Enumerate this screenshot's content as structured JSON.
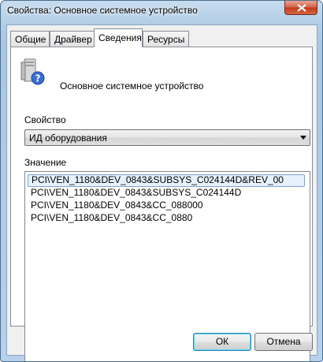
{
  "window": {
    "title": "Свойства: Основное системное устройство"
  },
  "tabs": [
    {
      "label": "Общие"
    },
    {
      "label": "Драйвер"
    },
    {
      "label": "Сведения"
    },
    {
      "label": "Ресурсы"
    }
  ],
  "active_tab": "Сведения",
  "device": {
    "name": "Основное системное устройство",
    "icon": "system-device-icon"
  },
  "property": {
    "label": "Свойство",
    "selected": "ИД оборудования"
  },
  "value": {
    "label": "Значение",
    "items": [
      "PCI\\VEN_1180&DEV_0843&SUBSYS_C024144D&REV_00",
      "PCI\\VEN_1180&DEV_0843&SUBSYS_C024144D",
      "PCI\\VEN_1180&DEV_0843&CC_088000",
      "PCI\\VEN_1180&DEV_0843&CC_0880"
    ],
    "selected_index": 0
  },
  "buttons": {
    "ok": "ОК",
    "cancel": "Отмена"
  },
  "colors": {
    "title_glass": "#b3cde6",
    "close_button": "#c23a1d",
    "selection": "#e5f1fb"
  }
}
